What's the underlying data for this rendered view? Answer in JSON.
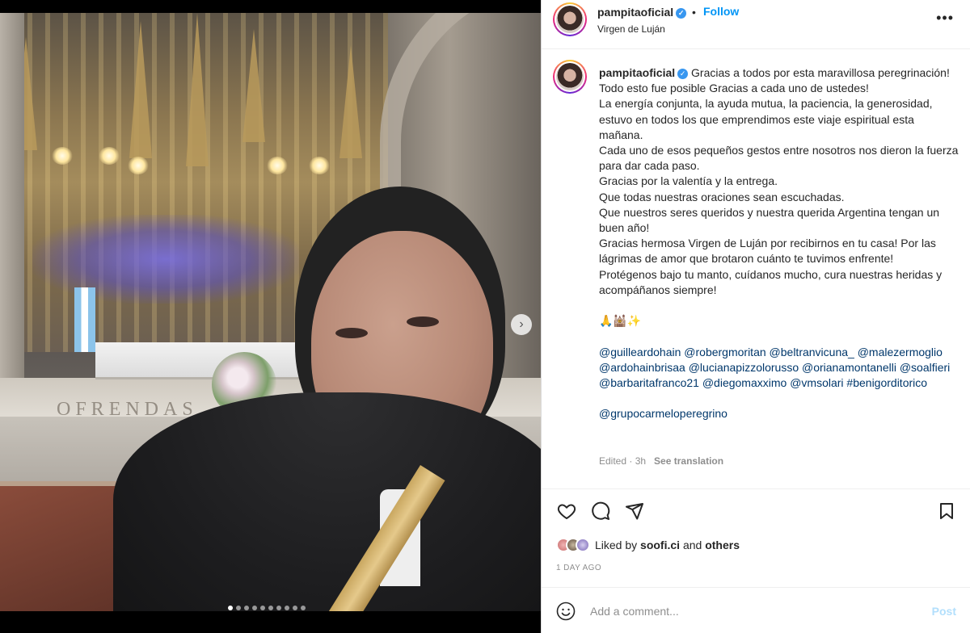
{
  "post": {
    "username": "pampitaoficial",
    "follow_label": "Follow",
    "separator": "•",
    "location": "Virgen de Luján",
    "more_label": "•••",
    "photo_overlay_text": "OFRENDAS"
  },
  "caption": {
    "username": "pampitaoficial",
    "lines": [
      "Gracias a todos por esta maravillosa peregrinación!",
      "Todo esto fue posible Gracias a cada uno de ustedes!",
      "La energía conjunta, la ayuda mutua, la paciencia, la generosidad, estuvo en todos los que emprendimos este viaje espiritual esta mañana.",
      "Cada uno de esos pequeños gestos entre nosotros nos dieron la fuerza para dar cada paso.",
      "Gracias por la valentía y la entrega.",
      "Que todas nuestras oraciones sean escuchadas.",
      "Que nuestros seres queridos y nuestra querida Argentina tengan un buen año!",
      "Gracias hermosa Virgen de Luján por recibirnos en tu casa! Por las lágrimas de amor que brotaron cuánto te tuvimos enfrente!",
      "Protégenos bajo tu manto, cuídanos mucho, cura nuestras heridas y acompáñanos siempre!"
    ],
    "emojis": "🙏🕍✨",
    "mentions_block": "@guilleardohain @robergmoritan @beltranvicuna_ @malezermoglio @ardohainbrisaa @lucianapizzolorusso @orianamontanelli @soalfieri @barbaritafranco21 @diegomaxximo @vmsolari #benigorditorico",
    "group_mention": "@grupocarmeloperegrino",
    "edited": "Edited · 3h",
    "see_translation": "See translation"
  },
  "likes": {
    "prefix": "Liked by",
    "user": "soofi.ci",
    "and": "and",
    "others": "others"
  },
  "time_ago": "1 DAY AGO",
  "comment": {
    "placeholder": "Add a comment...",
    "post_label": "Post"
  },
  "carousel": {
    "count": 10,
    "active_index": 0
  },
  "colors": {
    "link": "#00376b",
    "follow": "#0095f6",
    "post_disabled": "#b2dffc",
    "muted": "#8e8e8e"
  }
}
